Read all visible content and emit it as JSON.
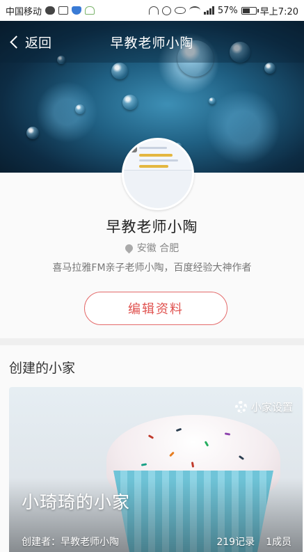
{
  "status_bar": {
    "carrier": "中国移动",
    "battery": "57%",
    "battery_level": 0.57,
    "time": "早上7:20"
  },
  "nav": {
    "back_label": "返回",
    "title": "早教老师小陶"
  },
  "profile": {
    "name": "早教老师小陶",
    "location": "安徽 合肥",
    "bio": "喜马拉雅FM亲子老师小陶，百度经验大神作者",
    "edit_button": "编辑资料"
  },
  "created_families": {
    "section_title": "创建的小家",
    "items": [
      {
        "name": "小琦琦的小家",
        "settings_label": "小家设置",
        "creator": "创建者：早教老师小陶",
        "records": "219记录",
        "members": "1成员"
      }
    ]
  }
}
